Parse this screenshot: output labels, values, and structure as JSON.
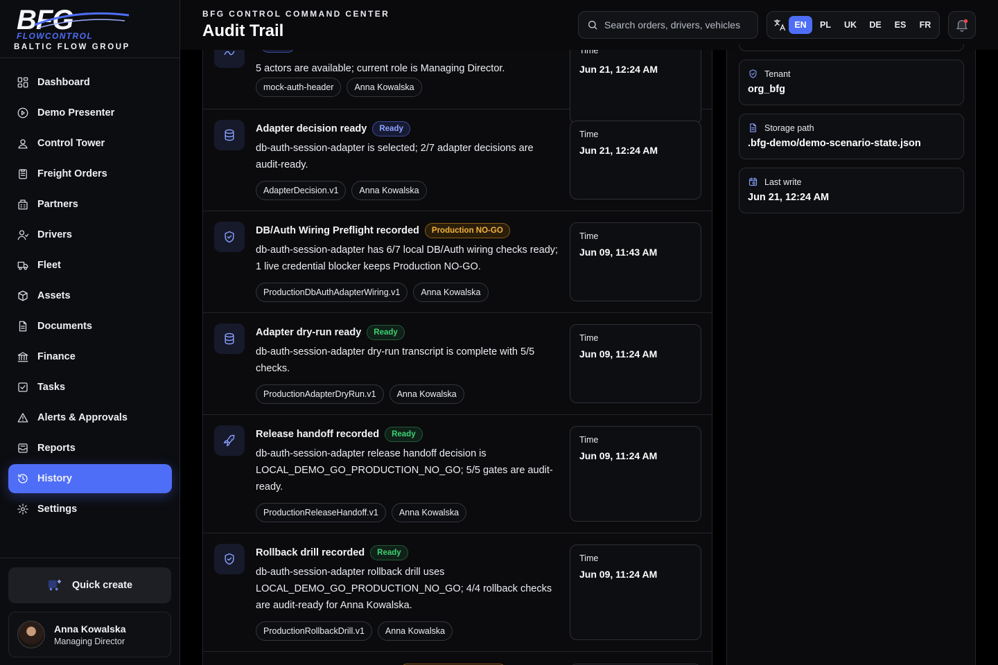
{
  "brand": {
    "logo_text": "BFG",
    "logo_sub": "FLOWCONTROL",
    "group": "BALTIC FLOW GROUP"
  },
  "colors": {
    "accent": "#4f6ef7",
    "ready_green": "#3fcf72",
    "nogo_orange": "#f3b33d"
  },
  "sidebar": {
    "items": [
      {
        "label": "Dashboard",
        "icon": "grid-icon"
      },
      {
        "label": "Demo Presenter",
        "icon": "play-circle-icon"
      },
      {
        "label": "Control Tower",
        "icon": "map-pin-icon"
      },
      {
        "label": "Freight Orders",
        "icon": "clipboard-icon"
      },
      {
        "label": "Partners",
        "icon": "building-icon"
      },
      {
        "label": "Drivers",
        "icon": "user-icon"
      },
      {
        "label": "Fleet",
        "icon": "truck-icon"
      },
      {
        "label": "Assets",
        "icon": "box-icon"
      },
      {
        "label": "Documents",
        "icon": "document-icon"
      },
      {
        "label": "Finance",
        "icon": "bank-icon"
      },
      {
        "label": "Tasks",
        "icon": "checkbox-icon"
      },
      {
        "label": "Alerts & Approvals",
        "icon": "alert-triangle-icon"
      },
      {
        "label": "Reports",
        "icon": "inbox-icon"
      },
      {
        "label": "History",
        "icon": "history-icon",
        "active": true
      },
      {
        "label": "Settings",
        "icon": "gear-icon"
      }
    ],
    "quick_create": "Quick create",
    "user": {
      "name": "Anna Kowalska",
      "role": "Managing Director"
    }
  },
  "header": {
    "kicker": "BFG CONTROL COMMAND CENTER",
    "title": "Audit Trail",
    "search_placeholder": "Search orders, drivers, vehicles",
    "languages": [
      "EN",
      "PL",
      "UK",
      "DE",
      "ES",
      "FR"
    ],
    "active_language": "EN"
  },
  "entries": [
    {
      "title": "",
      "badge": "",
      "badge_style": "blue",
      "icon": "trend-icon",
      "desc": "5 actors are available; current role is Managing Director.",
      "tags": [
        "mock-auth-header",
        "Anna Kowalska"
      ],
      "time_label": "Time",
      "time": "Jun 21, 12:24 AM"
    },
    {
      "title": "Adapter decision ready",
      "badge": "Ready",
      "badge_style": "blue",
      "icon": "database-icon",
      "desc": "db-auth-session-adapter is selected; 2/7 adapter decisions are audit-ready.",
      "tags": [
        "AdapterDecision.v1",
        "Anna Kowalska"
      ],
      "time_label": "Time",
      "time": "Jun 21, 12:24 AM"
    },
    {
      "title": "DB/Auth Wiring Preflight recorded",
      "badge": "Production NO-GO",
      "badge_style": "orange",
      "icon": "shield-icon",
      "desc": "db-auth-session-adapter has 6/7 local DB/Auth wiring checks ready; 1 live credential blocker keeps Production NO-GO.",
      "tags": [
        "ProductionDbAuthAdapterWiring.v1",
        "Anna Kowalska"
      ],
      "time_label": "Time",
      "time": "Jun 09, 11:43 AM"
    },
    {
      "title": "Adapter dry-run ready",
      "badge": "Ready",
      "badge_style": "green",
      "icon": "database-icon",
      "desc": "db-auth-session-adapter dry-run transcript is complete with 5/5 checks.",
      "tags": [
        "ProductionAdapterDryRun.v1",
        "Anna Kowalska"
      ],
      "time_label": "Time",
      "time": "Jun 09, 11:24 AM"
    },
    {
      "title": "Release handoff recorded",
      "badge": "Ready",
      "badge_style": "green",
      "icon": "rocket-icon",
      "desc": "db-auth-session-adapter release handoff decision is LOCAL_DEMO_GO_PRODUCTION_NO_GO; 5/5 gates are audit-ready.",
      "tags": [
        "ProductionReleaseHandoff.v1",
        "Anna Kowalska"
      ],
      "time_label": "Time",
      "time": "Jun 09, 11:24 AM"
    },
    {
      "title": "Rollback drill recorded",
      "badge": "Ready",
      "badge_style": "green",
      "icon": "shield-icon",
      "desc": "db-auth-session-adapter rollback drill uses LOCAL_DEMO_GO_PRODUCTION_NO_GO; 4/4 rollback checks are audit-ready for Anna Kowalska.",
      "tags": [
        "ProductionRollbackDrill.v1",
        "Anna Kowalska"
      ],
      "time_label": "Time",
      "time": "Jun 09, 11:24 AM"
    }
  ],
  "right_panel": [
    {
      "label": "Tenant",
      "value": "org_bfg",
      "icon": "shield-icon"
    },
    {
      "label": "Storage path",
      "value": ".bfg-demo/demo-scenario-state.json",
      "icon": "document-icon"
    },
    {
      "label": "Last write",
      "value": "Jun 21, 12:24 AM",
      "icon": "calendar-icon"
    }
  ]
}
